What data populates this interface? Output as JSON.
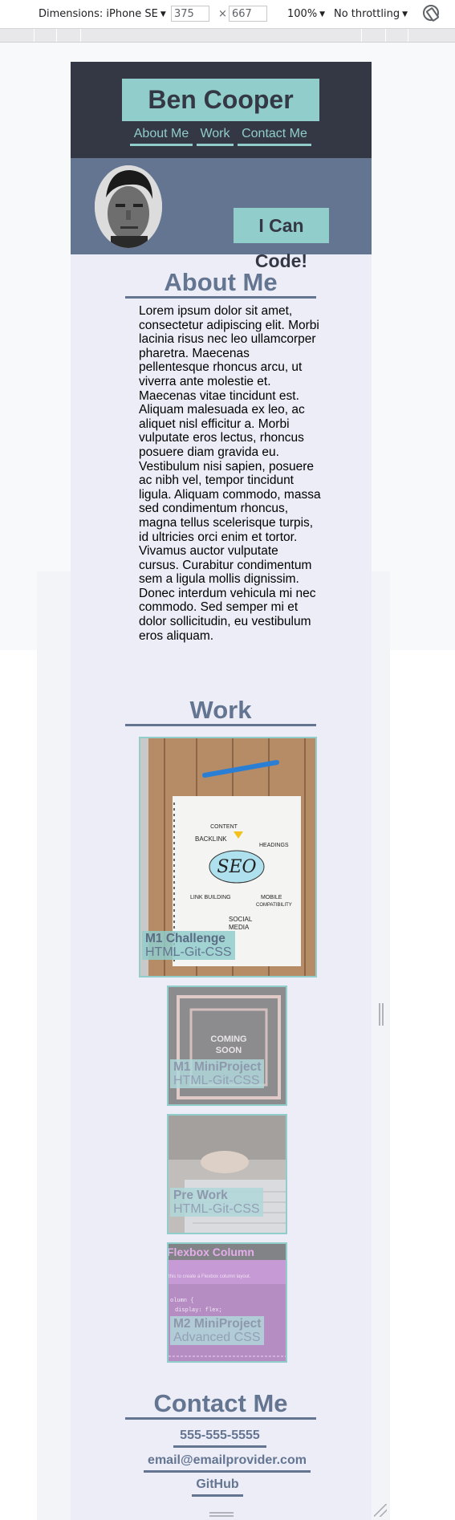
{
  "devtools": {
    "device_label": "Dimensions: iPhone SE",
    "width_value": "375",
    "height_value": "667",
    "times": "×",
    "zoom_label": "100%",
    "throttle_label": "No throttling"
  },
  "colors": {
    "dark": "#333844",
    "teal": "#91cdcb",
    "slate": "#647592",
    "page_bg": "#ecedf6"
  },
  "header": {
    "title": "Ben Cooper",
    "nav": [
      "About Me",
      "Work",
      "Contact Me"
    ]
  },
  "hero": {
    "tagline": "I Can Code!"
  },
  "about": {
    "heading": "About Me",
    "text": "Lorem ipsum dolor sit amet, consectetur adipiscing elit. Morbi lacinia risus nec leo ullamcorper pharetra. Maecenas pellentesque rhoncus arcu, ut viverra ante molestie et. Maecenas vitae tincidunt est. Aliquam malesuada ex leo, ac aliquet nisl efficitur a. Morbi vulputate eros lectus, rhoncus posuere diam gravida eu. Vestibulum nisi sapien, posuere ac nibh vel, tempor tincidunt ligula. Aliquam commodo, massa sed condimentum rhoncus, magna tellus scelerisque turpis, id ultricies orci enim et tortor. Vivamus auctor vulputate cursus. Curabitur condimentum sem a ligula mollis dignissim. Donec interdum vehicula mi nec commodo. Sed semper mi et dolor sollicitudin, eu vestibulum eros aliquam."
  },
  "work": {
    "heading": "Work",
    "projects": [
      {
        "title": "M1 Challenge",
        "subtitle": "HTML-Git-CSS",
        "image_words": [
          "CONTENT",
          "BACKLINK",
          "HEADINGS",
          "SEO",
          "LINK BUILDING",
          "MOBILE",
          "COMPATIBILITY",
          "SOCIAL",
          "MEDIA"
        ]
      },
      {
        "title": "M1 MiniProject",
        "subtitle": "HTML-Git-CSS",
        "image_words": [
          "COMING",
          "SOON"
        ]
      },
      {
        "title": "Pre Work",
        "subtitle": "HTML-Git-CSS",
        "image_words": []
      },
      {
        "title": "M2 MiniProject",
        "subtitle": "Advanced CSS",
        "image_words": [
          "Flexbox Column",
          "this to create a Flexbox column layout.",
          "olumn {",
          "display: flex;"
        ]
      }
    ]
  },
  "contact": {
    "heading": "Contact Me",
    "phone": "555-555-5555",
    "email": "email@emailprovider.com",
    "github": "GitHub"
  }
}
